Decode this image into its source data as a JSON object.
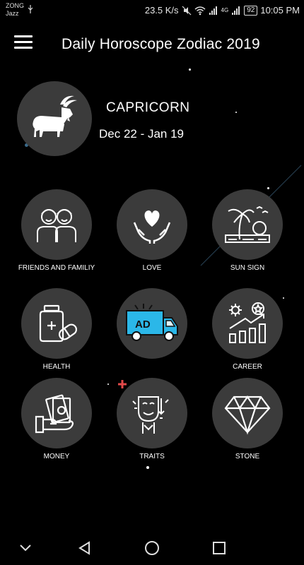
{
  "status_bar": {
    "carrier_line1": "ZONG",
    "carrier_line2": "Jazz",
    "speed": "23.5 K/s",
    "net_label": "4G",
    "battery": "92",
    "time": "10:05 PM"
  },
  "app_bar": {
    "title": "Daily Horoscope Zodiac 2019",
    "menu_icon": "hamburger-menu-icon"
  },
  "sign": {
    "name": "CAPRICORN",
    "dates": "Dec 22 - Jan 19",
    "icon": "goat-icon"
  },
  "tiles": [
    {
      "label": "FRIENDS AND FAMILIY",
      "icon": "friends-icon"
    },
    {
      "label": "LOVE",
      "icon": "heart-hands-icon"
    },
    {
      "label": "SUN SIGN",
      "icon": "beach-icon"
    },
    {
      "label": "HEALTH",
      "icon": "medicine-icon"
    },
    {
      "label": "",
      "icon": "ad-truck-icon"
    },
    {
      "label": "CAREER",
      "icon": "career-growth-icon"
    },
    {
      "label": "MONEY",
      "icon": "money-hand-icon"
    },
    {
      "label": "TRAITS",
      "icon": "masks-icon"
    },
    {
      "label": "STONE",
      "icon": "diamond-icon"
    }
  ],
  "ad_badge": "AD",
  "colors": {
    "background": "#000000",
    "circle": "#3b3b3b",
    "text": "#ffffff",
    "ad_truck": "#2bb7e8"
  },
  "nav_bar": [
    "chevron-down-icon",
    "back-triangle-icon",
    "home-circle-icon",
    "recents-square-icon"
  ]
}
